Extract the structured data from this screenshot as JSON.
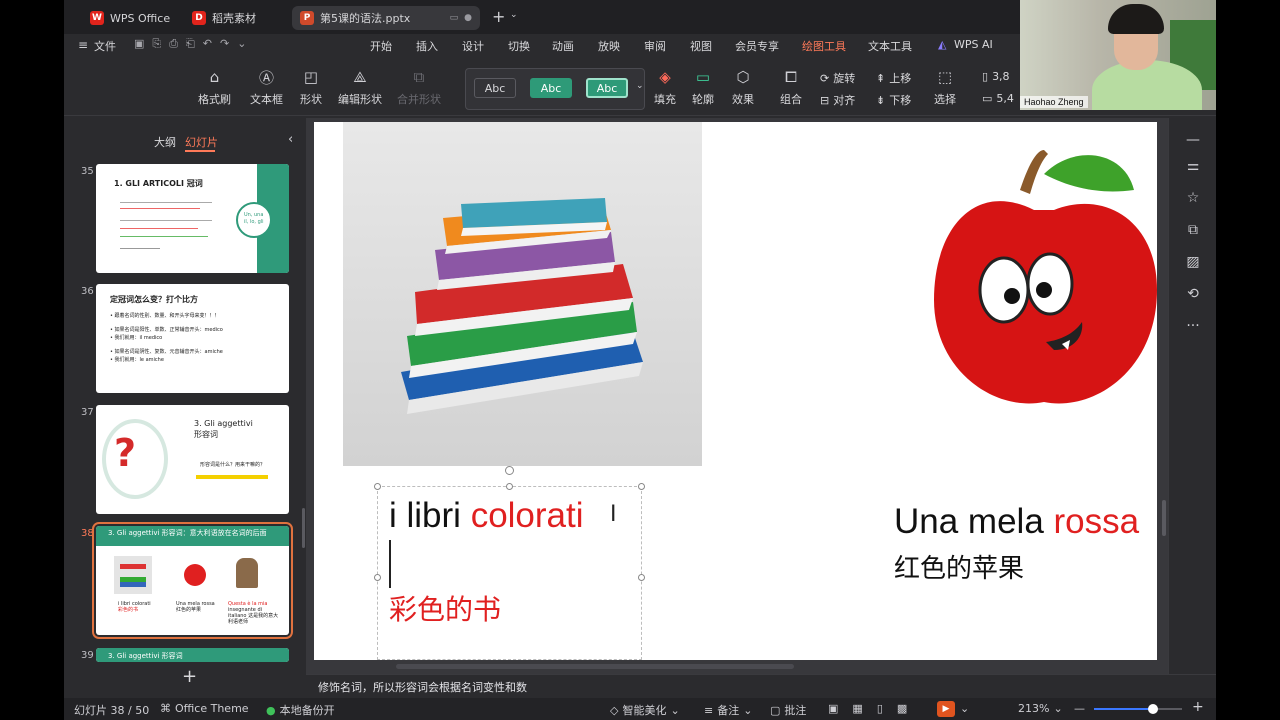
{
  "tabs": [
    {
      "label": "WPS Office",
      "icon": "wps-logo",
      "color": "#e1241c"
    },
    {
      "label": "稻壳素材",
      "icon": "docer-logo",
      "color": "#e1241c"
    },
    {
      "label": "第5课的语法.pptx",
      "icon": "ppt-logo",
      "color": "#d04a2b"
    }
  ],
  "file_menu": "文件",
  "menus": [
    "开始",
    "插入",
    "设计",
    "切换",
    "动画",
    "放映",
    "审阅",
    "视图",
    "会员专享",
    "绘图工具",
    "文本工具",
    "WPS AI"
  ],
  "active_menu": "绘图工具",
  "ribbon": {
    "format_painter": "格式刷",
    "textbox": "文本框",
    "shape": "形状",
    "edit_shape": "编辑形状",
    "merge_shape": "合并形状",
    "style_sample": "Abc",
    "fill": "填充",
    "outline": "轮廓",
    "effect": "效果",
    "group": "组合",
    "rotate": "旋转",
    "align": "对齐",
    "bring_forward": "上移",
    "send_backward": "下移",
    "select": "选择",
    "height_value": "3,8",
    "width_value": "5,4"
  },
  "left_panel": {
    "outline_tab": "大纲",
    "slides_tab": "幻灯片",
    "add_slide": "+"
  },
  "thumbs": [
    {
      "num": "35",
      "title": "1. GLI ARTICOLI 冠词",
      "badge_lines": [
        "Un, una",
        "uno",
        "il, lo, gli",
        "le"
      ],
      "lines": [
        "il, l', i, gli, lo, la, le"
      ]
    },
    {
      "num": "36",
      "title": "定冠词怎么变？打个比方",
      "lines": [
        "• 跟着名词的性别、数量、和开头字母来变！！！",
        "• 如果名词是阳性、单数、正常辅音开头：medico",
        "• 我们就用：il medico",
        "• 如果名词是阴性、复数、元音辅音开头：amiche",
        "• 我们就用：le amiche"
      ]
    },
    {
      "num": "37",
      "title": "3. Gli aggettivi",
      "subtitle": "形容词",
      "lines": [
        "形容词是什么？用来干嘛的？"
      ]
    },
    {
      "num": "38",
      "title": "3. Gli aggettivi 形容词：意大利语放在名词的后面",
      "captions": [
        [
          "i libri colorati",
          "彩色的书"
        ],
        [
          "Una mela rossa",
          "红色的苹果"
        ],
        [
          "Questa è la mia",
          "insegnante di",
          "italiano 这是我的意大利语老师"
        ]
      ]
    },
    {
      "num": "39",
      "title": "3. Gli aggettivi 形容词"
    }
  ],
  "slide": {
    "phrase1_black": "i libri ",
    "phrase1_red": "colorati",
    "phrase1_trans": "彩色的书",
    "phrase2_black": "Una mela ",
    "phrase2_red": "rossa",
    "phrase2_trans": "红色的苹果"
  },
  "notes": "修饰名词，所以形容词会根据名词变性和数",
  "status": {
    "slide_counter": "幻灯片 38 / 50",
    "theme": "Office Theme",
    "backup": "本地备份开",
    "beautify": "智能美化",
    "notes_btn": "备注",
    "comments_btn": "批注",
    "zoom": "213%"
  },
  "video": {
    "name": "Haohao Zheng"
  },
  "colors": {
    "accent": "#ff7a59",
    "red_text": "#e02020",
    "teal": "#2f9a7a"
  }
}
